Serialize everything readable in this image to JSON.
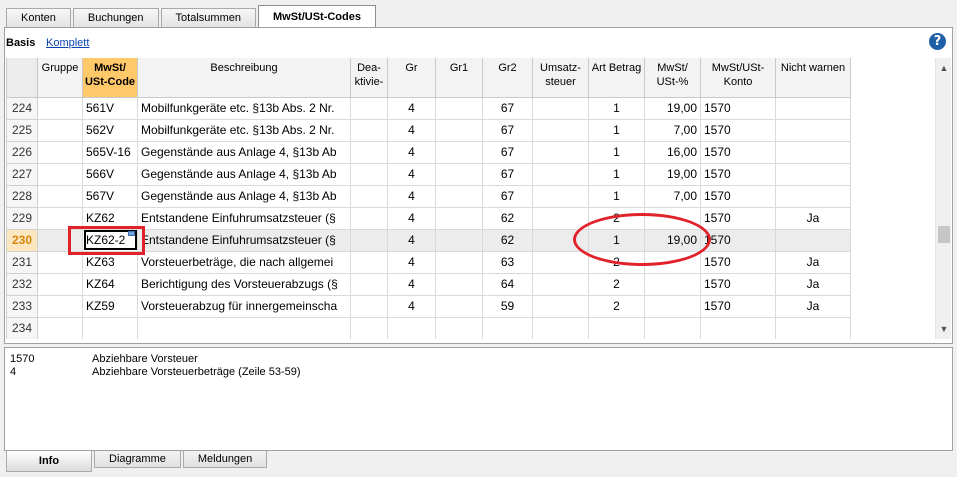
{
  "tabs_top": [
    "Konten",
    "Buchungen",
    "Totalsummen",
    "MwSt/USt-Codes"
  ],
  "view": {
    "basis": "Basis",
    "komplett": "Komplett"
  },
  "help_glyph": "?",
  "columns": [
    "",
    "Gruppe",
    "MwSt/\nUSt-Code",
    "Beschreibung",
    "Dea-\nktivie-",
    "Gr",
    "Gr1",
    "Gr2",
    "Umsatz-\nsteuer",
    "Art Betrag",
    "MwSt/\nUSt-%",
    "MwSt/USt-\nKonto",
    "Nicht warnen"
  ],
  "rows": [
    {
      "nr": "224",
      "gruppe": "",
      "code": "561V",
      "beschreibung": "Mobilfunkgeräte etc. §13b Abs. 2 Nr.",
      "deaktiviert": "",
      "gr": "4",
      "gr1": "",
      "gr2": "67",
      "umsatzsteuer": "",
      "art": "1",
      "prozent": "19,00",
      "konto": "1570",
      "nicht_warnen": ""
    },
    {
      "nr": "225",
      "gruppe": "",
      "code": "562V",
      "beschreibung": "Mobilfunkgeräte etc. §13b Abs. 2 Nr.",
      "deaktiviert": "",
      "gr": "4",
      "gr1": "",
      "gr2": "67",
      "umsatzsteuer": "",
      "art": "1",
      "prozent": "7,00",
      "konto": "1570",
      "nicht_warnen": ""
    },
    {
      "nr": "226",
      "gruppe": "",
      "code": "565V-16",
      "beschreibung": "Gegenstände aus Anlage 4, §13b Ab",
      "deaktiviert": "",
      "gr": "4",
      "gr1": "",
      "gr2": "67",
      "umsatzsteuer": "",
      "art": "1",
      "prozent": "16,00",
      "konto": "1570",
      "nicht_warnen": ""
    },
    {
      "nr": "227",
      "gruppe": "",
      "code": "566V",
      "beschreibung": "Gegenstände aus Anlage 4, §13b Ab",
      "deaktiviert": "",
      "gr": "4",
      "gr1": "",
      "gr2": "67",
      "umsatzsteuer": "",
      "art": "1",
      "prozent": "19,00",
      "konto": "1570",
      "nicht_warnen": ""
    },
    {
      "nr": "228",
      "gruppe": "",
      "code": "567V",
      "beschreibung": "Gegenstände aus Anlage 4, §13b Ab",
      "deaktiviert": "",
      "gr": "4",
      "gr1": "",
      "gr2": "67",
      "umsatzsteuer": "",
      "art": "1",
      "prozent": "7,00",
      "konto": "1570",
      "nicht_warnen": ""
    },
    {
      "nr": "229",
      "gruppe": "",
      "code": "KZ62",
      "beschreibung": "Entstandene Einfuhrumsatzsteuer (§",
      "deaktiviert": "",
      "gr": "4",
      "gr1": "",
      "gr2": "62",
      "umsatzsteuer": "",
      "art": "2",
      "prozent": "",
      "konto": "1570",
      "nicht_warnen": "Ja"
    },
    {
      "nr": "230",
      "gruppe": "",
      "code": "KZ62-2",
      "beschreibung": "Entstandene Einfuhrumsatzsteuer (§",
      "deaktiviert": "",
      "gr": "4",
      "gr1": "",
      "gr2": "62",
      "umsatzsteuer": "",
      "art": "1",
      "prozent": "19,00",
      "konto": "1570",
      "nicht_warnen": ""
    },
    {
      "nr": "231",
      "gruppe": "",
      "code": "KZ63",
      "beschreibung": "Vorsteuerbeträge, die nach allgemei",
      "deaktiviert": "",
      "gr": "4",
      "gr1": "",
      "gr2": "63",
      "umsatzsteuer": "",
      "art": "2",
      "prozent": "",
      "konto": "1570",
      "nicht_warnen": "Ja"
    },
    {
      "nr": "232",
      "gruppe": "",
      "code": "KZ64",
      "beschreibung": "Berichtigung des Vorsteuerabzugs (§",
      "deaktiviert": "",
      "gr": "4",
      "gr1": "",
      "gr2": "64",
      "umsatzsteuer": "",
      "art": "2",
      "prozent": "",
      "konto": "1570",
      "nicht_warnen": "Ja"
    },
    {
      "nr": "233",
      "gruppe": "",
      "code": "KZ59",
      "beschreibung": "Vorsteuerabzug für innergemeinscha",
      "deaktiviert": "",
      "gr": "4",
      "gr1": "",
      "gr2": "59",
      "umsatzsteuer": "",
      "art": "2",
      "prozent": "",
      "konto": "1570",
      "nicht_warnen": "Ja"
    },
    {
      "nr": "234",
      "gruppe": "",
      "code": "",
      "beschreibung": "",
      "deaktiviert": "",
      "gr": "",
      "gr1": "",
      "gr2": "",
      "umsatzsteuer": "",
      "art": "",
      "prozent": "",
      "konto": "",
      "nicht_warnen": ""
    }
  ],
  "selected_row": "230",
  "info": [
    {
      "key": "1570",
      "value": "Abziehbare Vorsteuer"
    },
    {
      "key": "4",
      "value": "Abziehbare Vorsteuerbeträge (Zeile 53-59)"
    }
  ],
  "tabs_bottom": [
    "Info",
    "Diagramme",
    "Meldungen"
  ],
  "colors": {
    "header_highlight": "#ffc969",
    "annotation": "#e2222b",
    "link": "#0645ad"
  }
}
